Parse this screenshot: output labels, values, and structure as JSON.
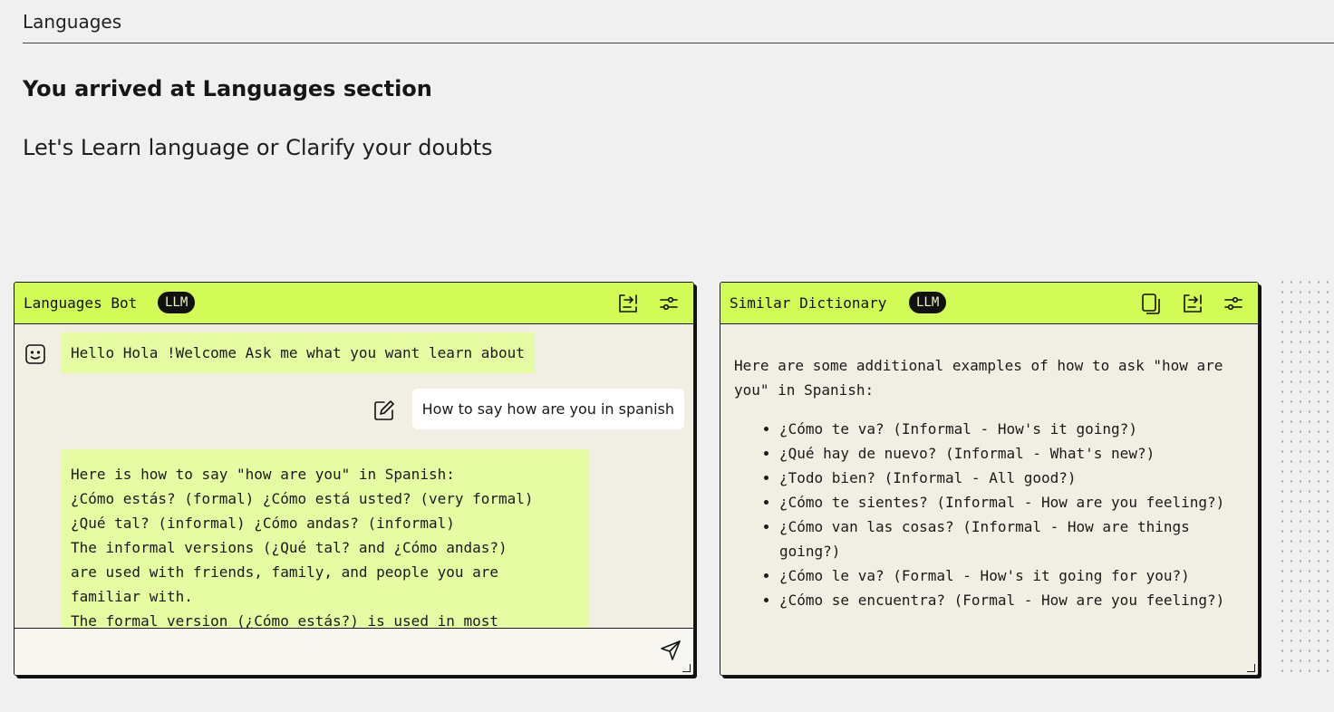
{
  "breadcrumb": "Languages",
  "page": {
    "title": "You arrived at Languages section",
    "subtitle": "Let's Learn language or Clarify your doubts"
  },
  "chat_panel": {
    "title": "Languages Bot",
    "badge": "LLM",
    "icons": [
      "share-icon",
      "settings-sliders-icon"
    ],
    "messages": [
      {
        "role": "bot",
        "text": "Hello Hola !Welcome Ask me what you want learn about"
      },
      {
        "role": "user",
        "text": "How to say how are you in spanish"
      },
      {
        "role": "bot",
        "text": "Here is how to say \"how are you\" in Spanish:\n¿Cómo estás? (formal) ¿Cómo está usted? (very formal)\n¿Qué tal? (informal) ¿Cómo andas? (informal)\nThe informal versions (¿Qué tal? and ¿Cómo andas?)\nare used with friends, family, and people you are\nfamiliar with.\nThe formal version (¿Cómo estás?) is used in most"
      }
    ],
    "input": {
      "value": "",
      "placeholder": ""
    }
  },
  "dictionary_panel": {
    "title": "Similar Dictionary",
    "badge": "LLM",
    "icons": [
      "copy-icon",
      "share-icon",
      "settings-sliders-icon"
    ],
    "intro": "Here are some additional examples of how to ask \"how are you\" in Spanish:",
    "items": [
      "¿Cómo te va? (Informal - How's it going?)",
      "¿Qué hay de nuevo? (Informal - What's new?)",
      "¿Todo bien? (Informal - All good?)",
      "¿Cómo te sientes? (Informal - How are you feeling?)",
      "¿Cómo van las cosas? (Informal - How are things going?)",
      "¿Cómo le va? (Formal - How's it going for you?)",
      "¿Cómo se encuentra? (Formal - How are you feeling?)"
    ]
  },
  "colors": {
    "header_accent": "#d2fb55",
    "bot_bubble": "#e6fca3",
    "panel_bg": "#f1eee3",
    "page_bg": "#f0f0f0"
  }
}
